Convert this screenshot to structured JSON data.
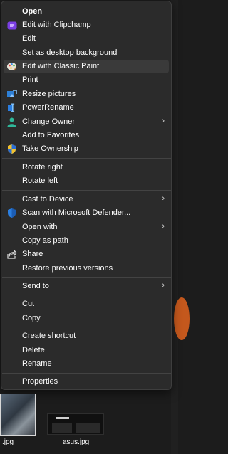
{
  "menu": {
    "items": [
      {
        "label": "Open",
        "icon": "none",
        "bold": true,
        "submenu": false
      },
      {
        "label": "Edit with Clipchamp",
        "icon": "clipchamp-icon",
        "submenu": false
      },
      {
        "label": "Edit",
        "icon": "none",
        "submenu": false
      },
      {
        "label": "Set as desktop background",
        "icon": "none",
        "submenu": false
      },
      {
        "label": "Edit with Classic Paint",
        "icon": "paint-palette-icon",
        "submenu": false,
        "highlighted": true
      },
      {
        "label": "Print",
        "icon": "none",
        "submenu": false
      },
      {
        "label": "Resize pictures",
        "icon": "resize-pictures-icon",
        "submenu": false
      },
      {
        "label": "PowerRename",
        "icon": "powerrename-icon",
        "submenu": false
      },
      {
        "label": "Change Owner",
        "icon": "user-icon",
        "submenu": true
      },
      {
        "label": "Add to Favorites",
        "icon": "none",
        "submenu": false
      },
      {
        "label": "Take Ownership",
        "icon": "shield-icon",
        "submenu": false
      },
      {
        "label": "Rotate right",
        "icon": "none",
        "submenu": false
      },
      {
        "label": "Rotate left",
        "icon": "none",
        "submenu": false
      },
      {
        "label": "Cast to Device",
        "icon": "none",
        "submenu": true
      },
      {
        "label": "Scan with Microsoft Defender...",
        "icon": "defender-shield-icon",
        "submenu": false
      },
      {
        "label": "Open with",
        "icon": "none",
        "submenu": true
      },
      {
        "label": "Copy as path",
        "icon": "none",
        "submenu": false
      },
      {
        "label": "Share",
        "icon": "share-icon",
        "submenu": false
      },
      {
        "label": "Restore previous versions",
        "icon": "none",
        "submenu": false
      },
      {
        "label": "Send to",
        "icon": "none",
        "submenu": true
      },
      {
        "label": "Cut",
        "icon": "none",
        "submenu": false
      },
      {
        "label": "Copy",
        "icon": "none",
        "submenu": false
      },
      {
        "label": "Create shortcut",
        "icon": "none",
        "submenu": false
      },
      {
        "label": "Delete",
        "icon": "none",
        "submenu": false
      },
      {
        "label": "Rename",
        "icon": "none",
        "submenu": false
      },
      {
        "label": "Properties",
        "icon": "none",
        "submenu": false
      }
    ],
    "chevron": "›"
  },
  "files": {
    "left_name": ".jpg",
    "right_name": "asus.jpg"
  },
  "colors": {
    "menu_bg": "#2b2b2b",
    "hover_bg": "#3a3a3a",
    "text": "#ffffff"
  }
}
